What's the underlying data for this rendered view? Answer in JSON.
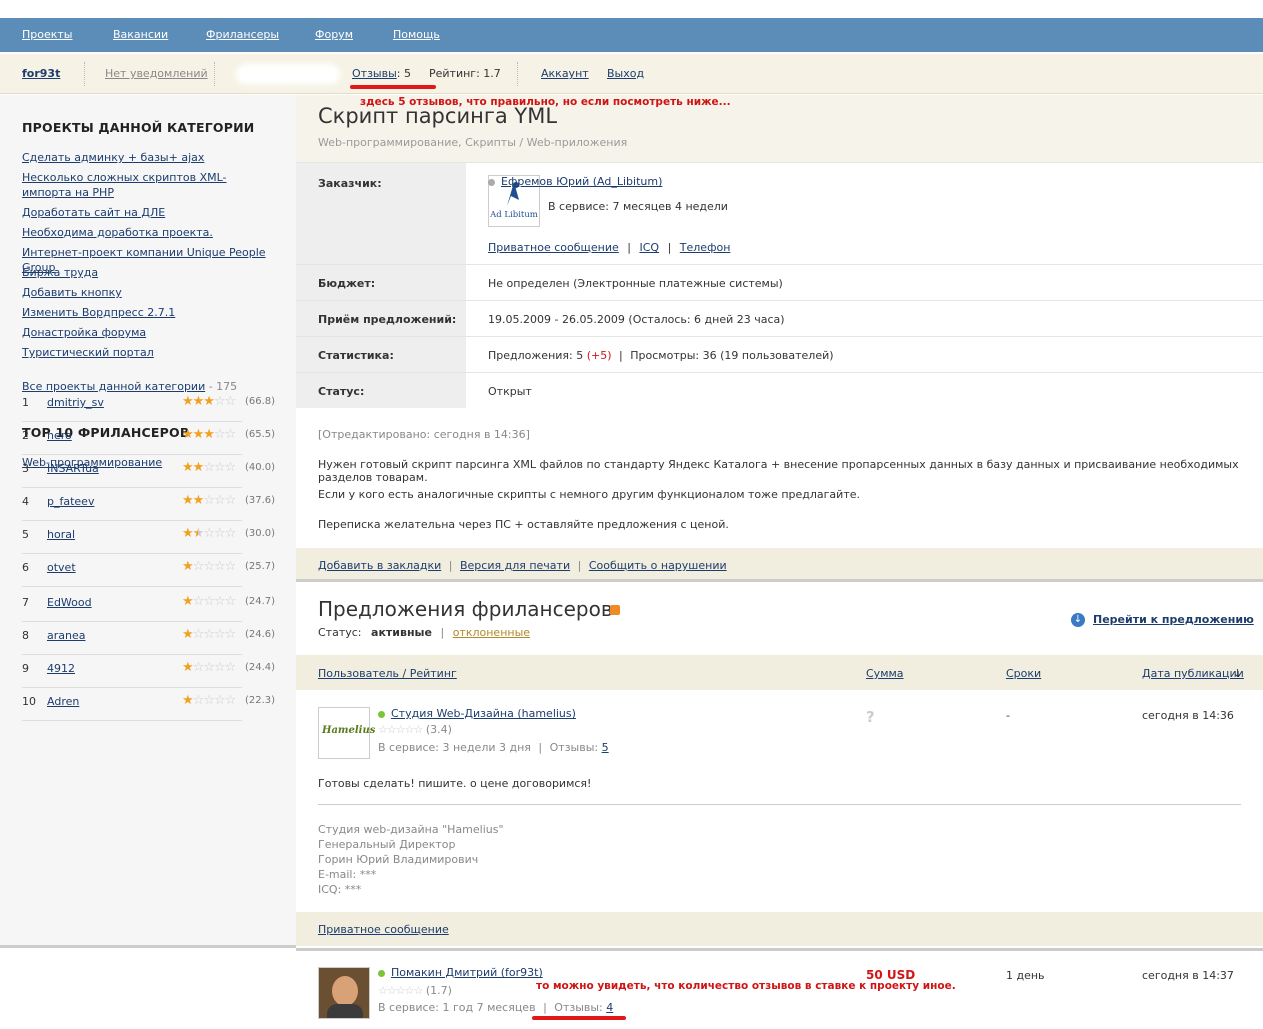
{
  "topnav": [
    "Проекты",
    "Вакансии",
    "Фрилансеры",
    "Форум",
    "Помощь"
  ],
  "userbar": {
    "username": "for93t",
    "notifications": "Нет уведомлений",
    "reviews_label": "Отзывы",
    "reviews_count": ": 5",
    "rating": "Рейтинг: 1.7",
    "account": "Аккаунт",
    "logout": "Выход"
  },
  "annotations": {
    "top": "здесь 5 отзывов, что правильно, но если посмотреть ниже...",
    "bottom": "то можно увидеть, что количество отзывов в ставке к проекту иное."
  },
  "sidebar": {
    "heading1": "ПРОЕКТЫ ДАННОЙ КАТЕГОРИИ",
    "projects": [
      "Сделать админку + базы+ ajax",
      "Несколько сложных скриптов XML-импорта на PHP",
      "Доработать сайт на ДЛЕ",
      "Необходима доработка проекта.",
      "Интернет-проект компании Unique People Group",
      "Биржа труда",
      "Добавить кнопку",
      "Изменить Вордпресс 2.7.1",
      "Донастройка форума",
      "Туристический портал"
    ],
    "all_projects": "Все проекты данной категории",
    "all_count": "-  175",
    "heading2": "TOP 10 ФРИЛАНСЕРОВ",
    "category": "Web-программирование",
    "freelancers": [
      {
        "n": "1",
        "name": "dmitriy_sv",
        "stars": 3,
        "score": "(66.8)"
      },
      {
        "n": "2",
        "name": "nero",
        "stars": 3,
        "score": "(65.5)"
      },
      {
        "n": "3",
        "name": "INSARTua",
        "stars": 2,
        "score": "(40.0)"
      },
      {
        "n": "4",
        "name": "p_fateev",
        "stars": 2,
        "score": "(37.6)"
      },
      {
        "n": "5",
        "name": "horal",
        "stars": 1.5,
        "score": "(30.0)"
      },
      {
        "n": "6",
        "name": "otvet",
        "stars": 1,
        "score": "(25.7)"
      },
      {
        "n": "7",
        "name": "EdWood",
        "stars": 1,
        "score": "(24.7)"
      },
      {
        "n": "8",
        "name": "aranea",
        "stars": 1,
        "score": "(24.6)"
      },
      {
        "n": "9",
        "name": "4912",
        "stars": 1,
        "score": "(24.4)"
      },
      {
        "n": "10",
        "name": "Adren",
        "stars": 1,
        "score": "(22.3)"
      }
    ]
  },
  "project": {
    "title": "Скрипт парсинга YML",
    "breadcrumb": "Web-программирование, Скрипты / Web-приложения",
    "customer_label": "Заказчик:",
    "customer_name": "Ефремов Юрий (Ad_Libitum)",
    "customer_logo": "Ad Libitum",
    "customer_service": "В сервисе: 7 месяцев 4 недели",
    "contact_links": [
      "Приватное сообщение",
      "ICQ",
      "Телефон"
    ],
    "budget_label": "Бюджет:",
    "budget": "Не определен  (Электронные платежные системы)",
    "accept_label": "Приём предложений:",
    "accept": "19.05.2009 - 26.05.2009  (Осталось: 6 дней 23 часа)",
    "stats_label": "Статистика:",
    "stats_offers": "Предложения: 5",
    "stats_plus": "(+5)",
    "stats_views": "Просмотры: 36 (19 пользователей)",
    "status_label": "Статус:",
    "status": "Открыт",
    "edited": "[Отредактировано: сегодня в 14:36]",
    "desc": [
      "Нужен готовый скрипт парсинга XML файлов по стандарту Яндекс Каталога + внесение пропарсенных данных в базу данных и присваивание необходимых разделов товарам.",
      "Если у кого есть аналогичные скрипты с немного другим функционалом тоже предлагайте.",
      "Переписка желательна через ПС + оставляйте предложения с ценой."
    ],
    "actions": [
      "Добавить в закладки",
      "Версия для печати",
      "Сообщить о нарушении"
    ]
  },
  "offers": {
    "title": "Предложения фрилансеров",
    "status_label": "Статус:",
    "status_active": "активные",
    "status_rejected": "отклоненные",
    "goto": "Перейти к предложению",
    "columns": {
      "user": "Пользователь / Рейтинг",
      "sum": "Сумма",
      "terms": "Сроки",
      "date": "Дата публикации"
    },
    "bid1": {
      "name": "Студия Web-Дизайна (hamelius)",
      "logo": "Hamelius",
      "rating": "(3.4)",
      "service": "В сервисе: 3 недели 3 дня",
      "reviews_label": "Отзывы:",
      "reviews": "5",
      "sum": "?",
      "terms": "-",
      "date": "сегодня в 14:36",
      "text": "Готовы сделать! пишите. о цене договоримся!",
      "signature": [
        "Студия web-дизайна \"Hamelius\"",
        "Генеральный Директор",
        "Горин Юрий Владимирович",
        "E-mail: ***",
        "ICQ: ***"
      ],
      "pm": "Приватное сообщение"
    },
    "bid2": {
      "name": "Помакин Дмитрий (for93t)",
      "rating": "(1.7)",
      "service": "В сервисе: 1 год 7 месяцев",
      "reviews_label": "Отзывы:",
      "reviews": "4",
      "sum": "50 USD",
      "terms": "1 день",
      "date": "сегодня в 14:37"
    }
  }
}
